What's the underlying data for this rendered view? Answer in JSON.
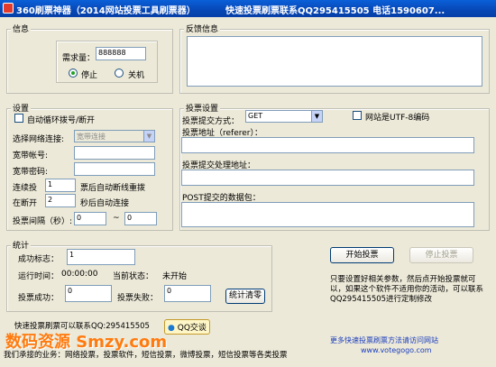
{
  "window": {
    "title": "360刷票神器（2014网站投票工具刷票器）",
    "contact": "快速投票刷票联系QQ295415505 电话1590607..."
  },
  "info_group": {
    "legend": "信息",
    "demand_label": "需求量：",
    "demand_value": "888888",
    "stop_label": "停止",
    "shutdown_label": "关机"
  },
  "feedback_group": {
    "legend": "反馈信息"
  },
  "settings_group": {
    "legend": "设置",
    "auto_redial_label": "自动循环拨号/断开",
    "network_label": "选择网络连接:",
    "network_value": "宽带连接",
    "broadband_account_label": "宽带帐号:",
    "broadband_password_label": "宽带密码:",
    "continuous_label": "连续投",
    "continuous_value": "1",
    "continuous_suffix": "票后自动断线重拨",
    "reconnect_label": "在断开",
    "reconnect_value": "2",
    "reconnect_suffix": "秒后自动连接",
    "interval_label": "投票间隔（秒）:",
    "interval_from": "0",
    "interval_sep": "~",
    "interval_to": "0"
  },
  "vote_group": {
    "legend": "投票设置",
    "method_label": "投票提交方式：",
    "method_value": "GET",
    "utf8_label": "网站是UTF-8编码",
    "url_label": "投票地址（referer）：",
    "handler_label": "投票提交处理地址：",
    "post_label": "POST提交的数据包："
  },
  "stats_group": {
    "legend": "统计",
    "success_flag_label": "成功标志：",
    "success_flag_value": "1",
    "runtime_label": "运行时间：",
    "runtime_value": "00:00:00",
    "status_label": "当前状态：",
    "status_value": "未开始",
    "success_count_label": "投票成功：",
    "success_count_value": "0",
    "fail_count_label": "投票失败：",
    "fail_count_value": "0",
    "clear_button": "统计清零"
  },
  "actions": {
    "start_button": "开始投票",
    "stop_button": "停止投票",
    "hint": "只要设置好相关参数，然后点开始投票就可以，如果这个软件不适用你的活动，可以联系QQ295415505进行定制修改"
  },
  "footer": {
    "contact_text": "快速投票刷票可以联系QQ:295415505",
    "qq_button": "QQ交谈",
    "watermark": "数码资源 Smzy.com",
    "services": "我们承接的业务：网络投票，投票软件，短信投票，微博投票，短信投票等各类投票",
    "more_link": "更多快速投票刷票方法请访问网站",
    "url": "www.votegogo.com"
  },
  "colors": {
    "title_bar": "#0747b5",
    "face": "#ece9d8",
    "watermark": "#ff7b0f",
    "link": "#1a3dbd"
  }
}
